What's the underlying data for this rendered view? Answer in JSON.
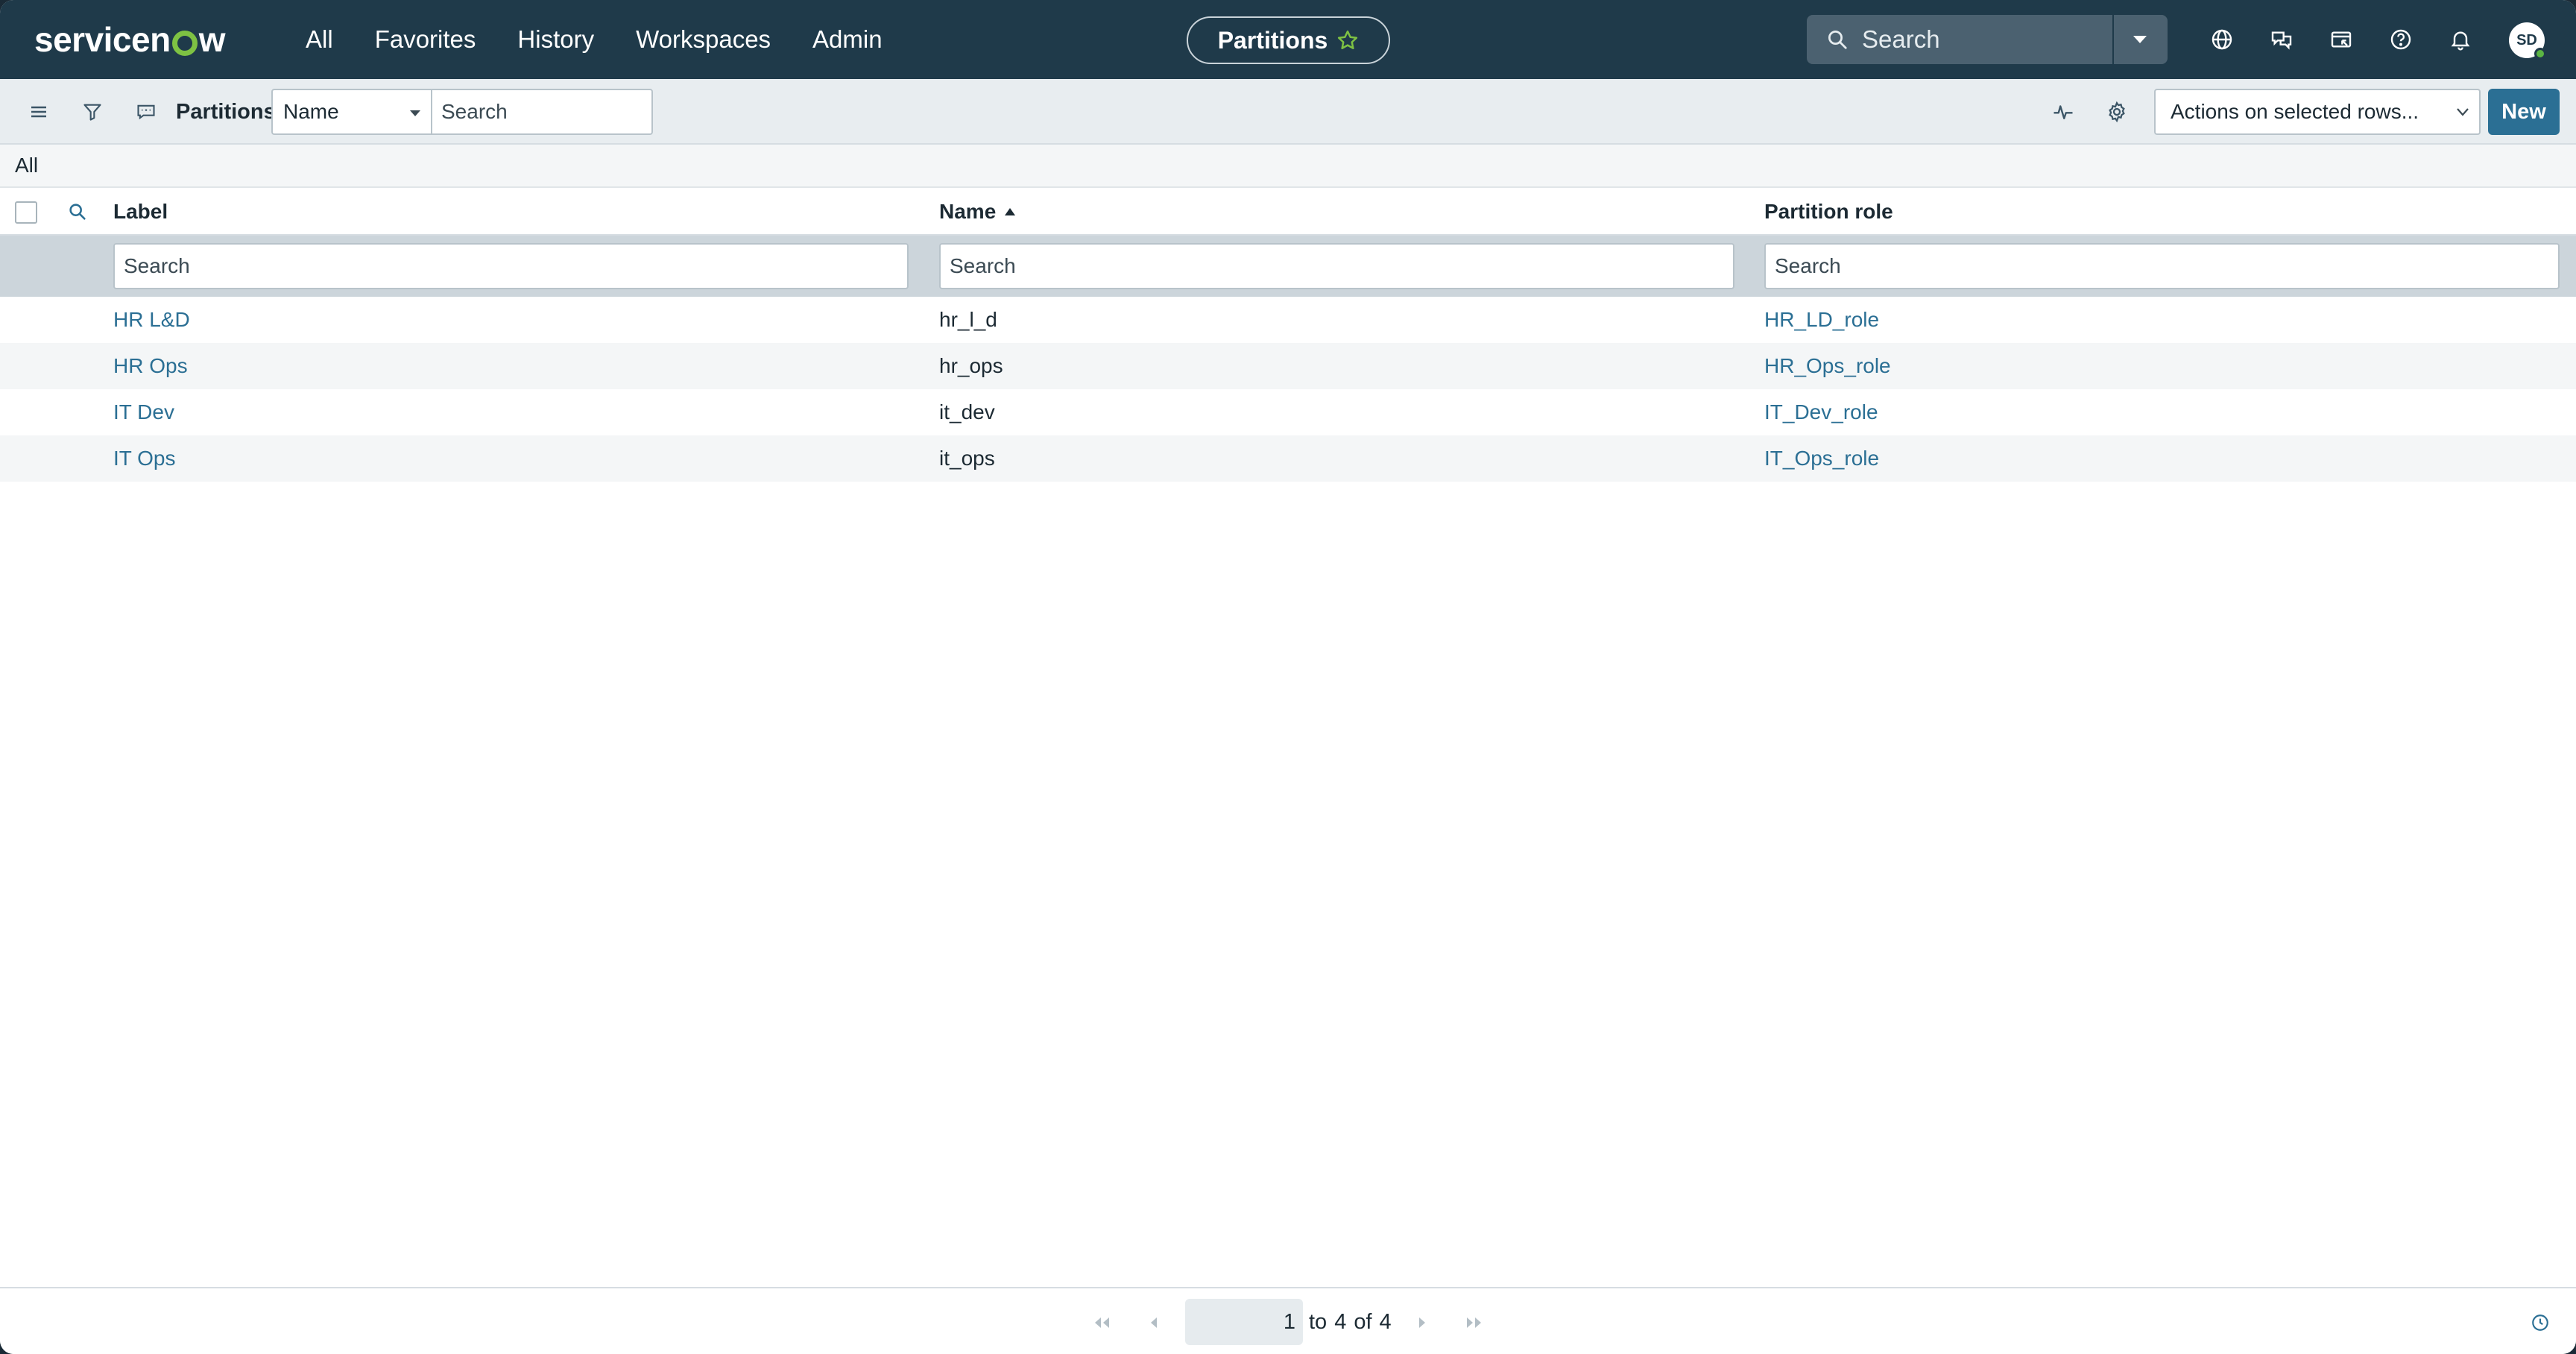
{
  "topnav": {
    "logo_text_start": "servicen",
    "logo_text_end": "w",
    "links": [
      "All",
      "Favorites",
      "History",
      "Workspaces",
      "Admin"
    ],
    "context_pill": "Partitions",
    "search_placeholder": "Search",
    "avatar_initials": "SD",
    "icons": [
      "globe-icon",
      "chat-icon",
      "image-icon",
      "help-icon",
      "bell-icon"
    ]
  },
  "toolbar": {
    "title": "Partitions",
    "field_select": "Name",
    "search_placeholder": "Search",
    "actions_select": "Actions on selected rows...",
    "new_label": "New"
  },
  "breadcrumb": "All",
  "table": {
    "columns": [
      {
        "label": "Label",
        "filter_placeholder": "Search"
      },
      {
        "label": "Name",
        "filter_placeholder": "Search",
        "sorted": "asc"
      },
      {
        "label": "Partition role",
        "filter_placeholder": "Search"
      }
    ],
    "rows": [
      {
        "label": "HR L&D",
        "name": "hr_l_d",
        "role": "HR_LD_role"
      },
      {
        "label": "HR Ops",
        "name": "hr_ops",
        "role": "HR_Ops_role"
      },
      {
        "label": "IT Dev",
        "name": "it_dev",
        "role": "IT_Dev_role"
      },
      {
        "label": "IT Ops",
        "name": "it_ops",
        "role": "IT_Ops_role"
      }
    ]
  },
  "pagination": {
    "current": "1",
    "to_word": "to",
    "end": "4",
    "of_word": "of",
    "total": "4"
  },
  "colors": {
    "nav_bg": "#1f3a4a",
    "accent": "#2b6f94",
    "logo_green": "#7ec243"
  }
}
